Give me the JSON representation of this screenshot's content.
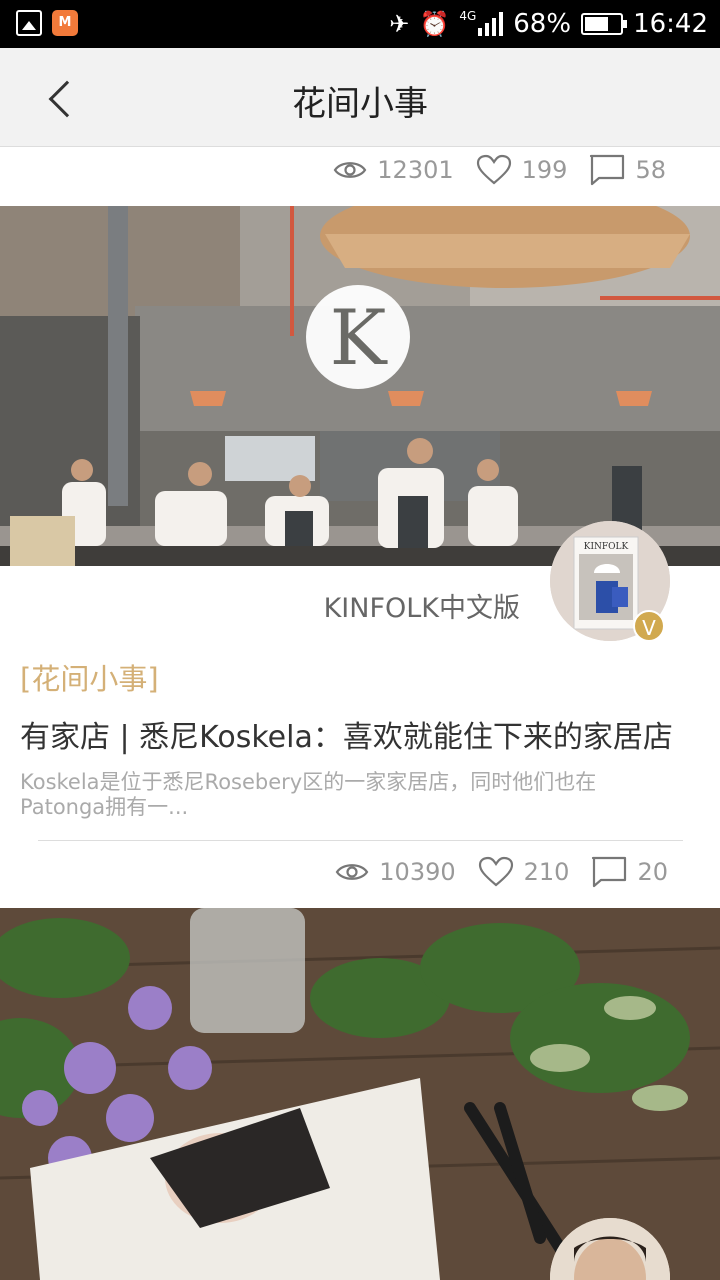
{
  "status_bar": {
    "app_badge": "M",
    "network": "4G",
    "battery": "68%",
    "battery_level": 0.68,
    "time": "16:42"
  },
  "header": {
    "title": "花间小事",
    "back_icon": "chevron-left-icon"
  },
  "articles": [
    {
      "views": "12301",
      "likes": "199",
      "comments": "58"
    },
    {
      "author": "KINFOLK中文版",
      "verified_badge": "V",
      "category": "[花间小事]",
      "title": "有家店 | 悉尼Koskela：喜欢就能住下来的家居店",
      "summary": "Koskela是位于悉尼Rosebery区的一家家居店，同时他们也在Patonga拥有一...",
      "logo_letter": "K",
      "magazine_name": "KINFOLK",
      "views": "10390",
      "likes": "210",
      "comments": "20"
    }
  ],
  "icons": {
    "view": "eye-icon",
    "like": "heart-icon",
    "comment": "comment-icon"
  },
  "colors": {
    "accent": "#d4b077",
    "badge": "#d1a94f"
  }
}
